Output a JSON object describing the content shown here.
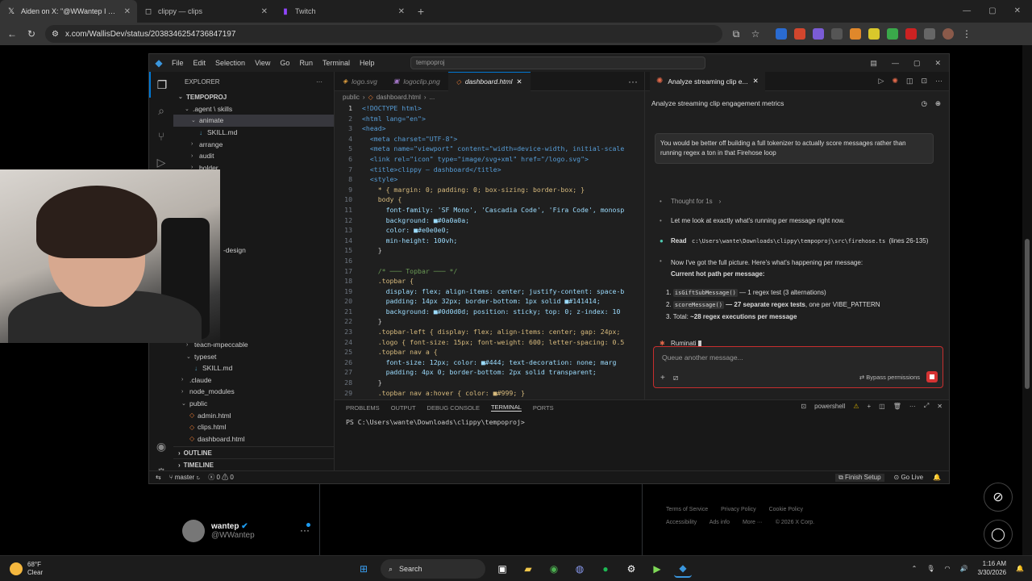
{
  "browser": {
    "tabs": [
      {
        "title": "Aiden on X: \"@WWantep I gen",
        "icon": "x-logo-icon",
        "active": true
      },
      {
        "title": "clippy — clips",
        "icon": "page-icon",
        "active": false
      },
      {
        "title": "Twitch",
        "icon": "twitch-icon",
        "active": false
      }
    ],
    "url": "x.com/WallisDev/status/2038346254736847197"
  },
  "vscode": {
    "menu": [
      "File",
      "Edit",
      "Selection",
      "View",
      "Go",
      "Run",
      "Terminal",
      "Help"
    ],
    "search": "tempoproj",
    "explorer": {
      "header": "EXPLORER",
      "root": "TEMPOPROJ",
      "items": [
        {
          "label": ".agent \\ skills",
          "indent": 1,
          "type": "folder-open"
        },
        {
          "label": "animate",
          "indent": 2,
          "type": "folder-open",
          "selected": true
        },
        {
          "label": "SKILL.md",
          "indent": 3,
          "type": "md"
        },
        {
          "label": "arrange",
          "indent": 2,
          "type": "folder"
        },
        {
          "label": "audit",
          "indent": 2,
          "type": "folder"
        },
        {
          "label": "bolder",
          "indent": 2,
          "type": "folder"
        }
      ],
      "lower_items": [
        {
          "label": "-design",
          "indent": 2,
          "type": "plain"
        },
        {
          "label": "teach-impeccable",
          "indent": 2,
          "type": "folder"
        },
        {
          "label": "typeset",
          "indent": 2,
          "type": "folder-open"
        },
        {
          "label": "SKILL.md",
          "indent": 3,
          "type": "md"
        },
        {
          "label": ".claude",
          "indent": 1,
          "type": "folder"
        },
        {
          "label": "node_modules",
          "indent": 1,
          "type": "folder"
        },
        {
          "label": "public",
          "indent": 1,
          "type": "folder-open"
        },
        {
          "label": "admin.html",
          "indent": 2,
          "type": "html"
        },
        {
          "label": "clips.html",
          "indent": 2,
          "type": "html"
        },
        {
          "label": "dashboard.html",
          "indent": 2,
          "type": "html"
        }
      ],
      "outline": "OUTLINE",
      "timeline": "TIMELINE"
    },
    "editor_tabs": [
      {
        "label": "logo.svg",
        "active": false
      },
      {
        "label": "logoclip.png",
        "active": false
      },
      {
        "label": "dashboard.html",
        "active": true
      }
    ],
    "breadcrumb": [
      "public",
      "dashboard.html",
      "..."
    ],
    "code_lines": [
      "<!DOCTYPE html>",
      "<html lang=\"en\">",
      "<head>",
      "  <meta charset=\"UTF-8\">",
      "  <meta name=\"viewport\" content=\"width=device-width, initial-scale",
      "  <link rel=\"icon\" type=\"image/svg+xml\" href=\"/logo.svg\">",
      "  <title>clippy — dashboard</title>",
      "  <style>",
      "    * { margin: 0; padding: 0; box-sizing: border-box; }",
      "    body {",
      "      font-family: 'SF Mono', 'Cascadia Code', 'Fira Code', monosp",
      "      background: ■#0a0a0a;",
      "      color: ■#e0e0e0;",
      "      min-height: 100vh;",
      "    }",
      "",
      "    /* ─── Topbar ─── */",
      "    .topbar {",
      "      display: flex; align-items: center; justify-content: space-b",
      "      padding: 14px 32px; border-bottom: 1px solid ■#141414;",
      "      background: ■#0d0d0d; position: sticky; top: 0; z-index: 10",
      "    }",
      "    .topbar-left { display: flex; align-items: center; gap: 24px;",
      "    .logo { font-size: 15px; font-weight: 600; letter-spacing: 0.5",
      "    .topbar nav a {",
      "      font-size: 12px; color: ■#444; text-decoration: none; marg",
      "      padding: 4px 0; border-bottom: 2px solid transparent;",
      "    }",
      "    .topbar nav a:hover { color: ■#999; }"
    ],
    "panel_tabs": [
      "PROBLEMS",
      "OUTPUT",
      "DEBUG CONSOLE",
      "TERMINAL",
      "PORTS"
    ],
    "active_panel_tab": "TERMINAL",
    "terminal_name": "powershell",
    "terminal_prompt": "PS C:\\Users\\wante\\Downloads\\clippy\\tempoproj>",
    "status": {
      "branch": "master",
      "errors": "0",
      "warnings": "0",
      "finish_setup": "Finish Setup",
      "go_live": "Go Live"
    }
  },
  "chat": {
    "tab_title": "Analyze streaming clip e...",
    "header_title": "Analyze streaming clip engagement metrics",
    "user_message": "You would be better off building a full tokenizer to actually score messages rather than running regex a ton in that Firehose loop",
    "thought": "Thought for 1s",
    "line1": "Let me look at exactly what's running per message right now.",
    "read_label": "Read",
    "read_path": "c:\\Users\\wante\\Downloads\\clippy\\tempoproj\\src\\firehose.ts",
    "read_lines": "(lines 26-135)",
    "picture_line": "Now I've got the full picture. Here's what's happening per message:",
    "hot_path_title": "Current hot path per message:",
    "list": [
      {
        "num": "1.",
        "code": "isGiftSubMessage()",
        "text": "— 1 regex test (3 alternations)"
      },
      {
        "num": "2.",
        "code": "scoreMessage()",
        "bold": "— 27 separate regex tests",
        "text": ", one per VIBE_PATTERN"
      },
      {
        "num": "3.",
        "plain": "Total: ",
        "bold": "~28 regex executions per message"
      }
    ],
    "status_word": "Ruminati",
    "input_placeholder": "Queue another message...",
    "bypass": "Bypass permissions"
  },
  "xpage": {
    "user_name": "wantep",
    "user_handle": "@WWantep",
    "footer": [
      "Terms of Service",
      "Privacy Policy",
      "Cookie Policy",
      "Accessibility",
      "Ads info",
      "More ···",
      "© 2026 X Corp."
    ]
  },
  "taskbar": {
    "temp": "68°F",
    "weather": "Clear",
    "search": "Search",
    "time": "1:16 AM",
    "date": "3/30/2026"
  }
}
